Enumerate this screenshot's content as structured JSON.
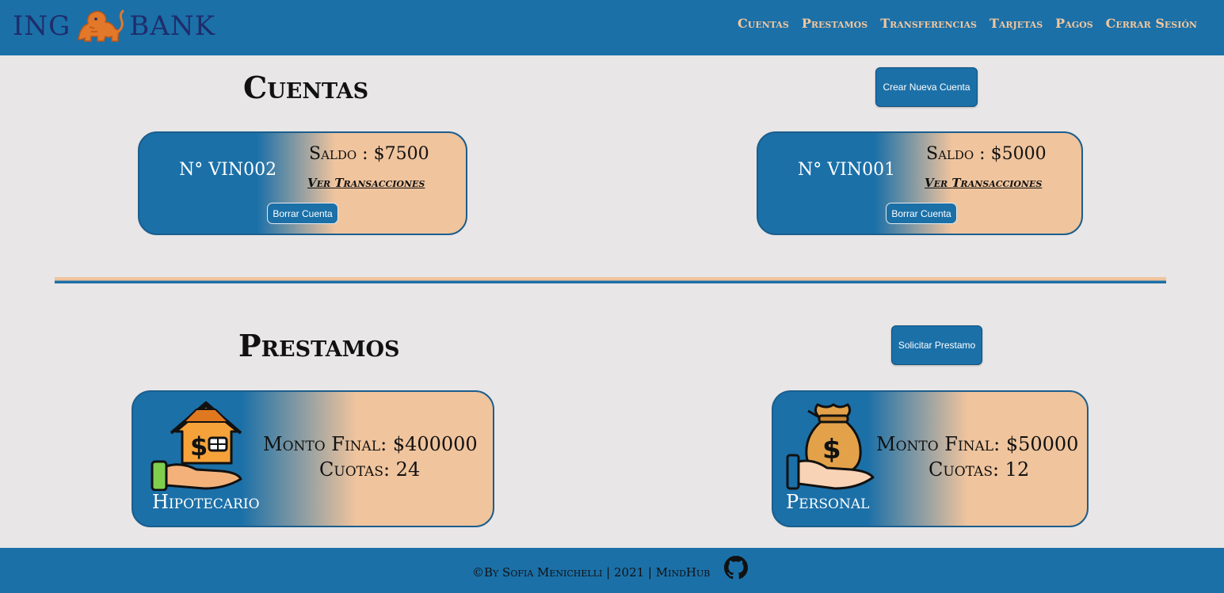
{
  "header": {
    "logo_left": "ING",
    "logo_right": "BANK",
    "nav": [
      "Cuentas",
      "Prestamos",
      "Transferencias",
      "Tarjetas",
      "Pagos",
      "Cerrar Sesión"
    ]
  },
  "accounts": {
    "title": "Cuentas",
    "create_button": "Crear Nueva Cuenta",
    "items": [
      {
        "number": "N° VIN002",
        "balance": "Saldo : $7500",
        "link": "Ver Transacciones",
        "delete": "Borrar Cuenta"
      },
      {
        "number": "N° VIN001",
        "balance": "Saldo : $5000",
        "link": "Ver Transacciones",
        "delete": "Borrar Cuenta"
      }
    ]
  },
  "loans": {
    "title": "Prestamos",
    "request_button": "Solicitar Prestamo",
    "items": [
      {
        "icon": "house-in-hand-icon",
        "amount": "Monto Final: $400000",
        "quotas": "Cuotas: 24",
        "name": "Hipotecario"
      },
      {
        "icon": "money-bag-in-hand-icon",
        "amount": "Monto Final: $50000",
        "quotas": "Cuotas: 12",
        "name": "Personal"
      }
    ]
  },
  "footer": {
    "text": "©By Sofia Menichelli | 2021 | MindHub",
    "icon": "github-icon"
  },
  "colors": {
    "primary": "#1b70a8",
    "accent": "#f0c49d",
    "background": "#e8e6e6"
  }
}
